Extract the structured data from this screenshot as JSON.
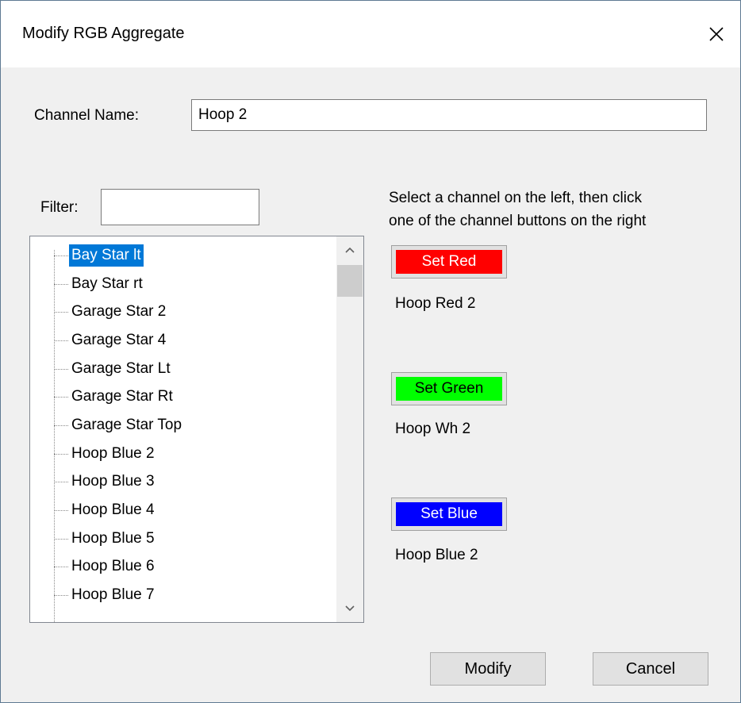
{
  "window": {
    "title": "Modify RGB Aggregate"
  },
  "icons": {
    "close": "close-icon",
    "scroll_up": "chevron-up-icon",
    "scroll_down": "chevron-down-icon"
  },
  "channel_name": {
    "label": "Channel Name:",
    "value": "Hoop 2"
  },
  "filter": {
    "label": "Filter:",
    "value": ""
  },
  "instructions": {
    "line1": "Select a channel on the left, then click",
    "line2": "one of the channel buttons on the right"
  },
  "tree": {
    "items": [
      {
        "label": "Bay Star lt",
        "selected": true
      },
      {
        "label": "Bay Star rt"
      },
      {
        "label": "Garage Star 2"
      },
      {
        "label": "Garage Star 4"
      },
      {
        "label": "Garage Star Lt"
      },
      {
        "label": "Garage Star Rt"
      },
      {
        "label": "Garage Star Top"
      },
      {
        "label": "Hoop  Blue 2"
      },
      {
        "label": "Hoop  Blue 3"
      },
      {
        "label": "Hoop  Blue 4"
      },
      {
        "label": "Hoop  Blue 5"
      },
      {
        "label": "Hoop  Blue 6"
      },
      {
        "label": "Hoop  Blue 7"
      }
    ]
  },
  "channels": {
    "red": {
      "button": "Set Red",
      "color": "#ff0000",
      "text_color": "#ffffff",
      "assigned": "Hoop Red 2"
    },
    "green": {
      "button": "Set Green",
      "color": "#00ff00",
      "text_color": "#000000",
      "assigned": "Hoop Wh 2"
    },
    "blue": {
      "button": "Set Blue",
      "color": "#0000ff",
      "text_color": "#ffffff",
      "assigned": "Hoop  Blue 2"
    }
  },
  "buttons": {
    "modify": "Modify",
    "cancel": "Cancel"
  }
}
